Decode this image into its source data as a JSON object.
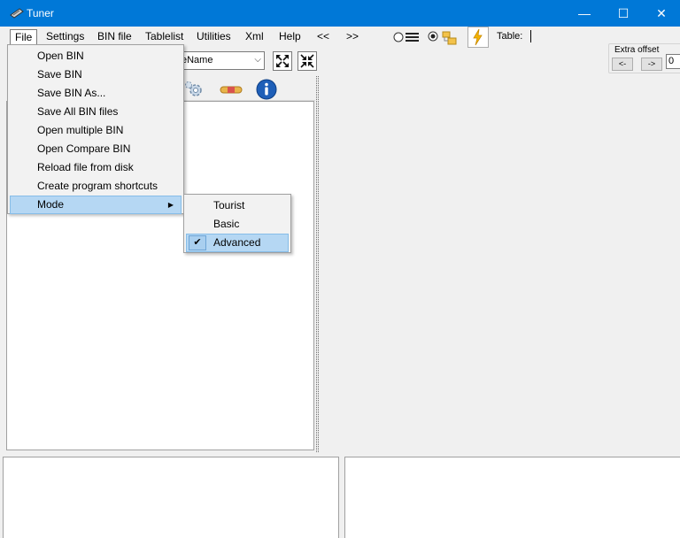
{
  "window": {
    "title": "Tuner",
    "minimize": "—",
    "maximize": "☐",
    "close": "✕"
  },
  "menu": {
    "file": "File",
    "settings": "Settings",
    "bin_file": "BIN file",
    "tablelist": "Tablelist",
    "utilities": "Utilities",
    "xml": "Xml",
    "help": "Help",
    "prev": "<<",
    "next": ">>"
  },
  "toolbar": {
    "table_label": "Table:"
  },
  "table_combo": {
    "value": "eName"
  },
  "extra_offset": {
    "label": "Extra offset",
    "prev": "<-",
    "next": "->",
    "value": "0"
  },
  "file_menu": {
    "items": [
      "Open BIN",
      "Save BIN",
      "Save BIN As...",
      "Save All BIN files",
      "Open multiple BIN",
      "Open Compare BIN",
      "Reload file from disk",
      "Create program shortcuts"
    ],
    "mode": "Mode"
  },
  "mode_menu": {
    "tourist": "Tourist",
    "basic": "Basic",
    "advanced": "Advanced",
    "checked": "Advanced"
  },
  "colors": {
    "titlebar": "#0078d7",
    "highlight": "#b5d7f3",
    "info_blue": "#1e5fb8"
  }
}
